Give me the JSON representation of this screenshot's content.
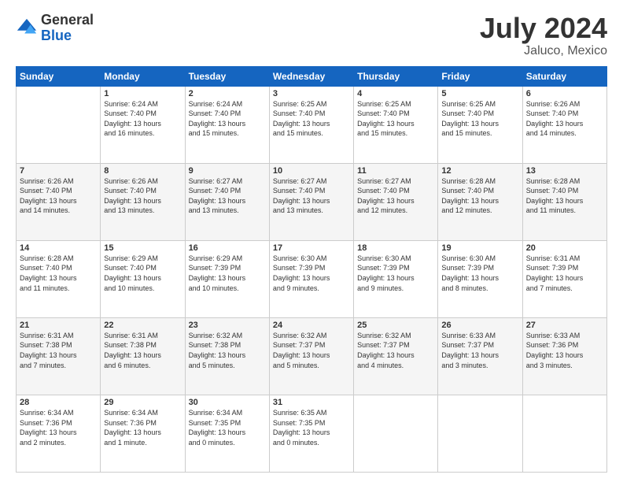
{
  "logo": {
    "general": "General",
    "blue": "Blue"
  },
  "title": "July 2024",
  "subtitle": "Jaluco, Mexico",
  "weekdays": [
    "Sunday",
    "Monday",
    "Tuesday",
    "Wednesday",
    "Thursday",
    "Friday",
    "Saturday"
  ],
  "weeks": [
    [
      {
        "day": "",
        "info": ""
      },
      {
        "day": "1",
        "info": "Sunrise: 6:24 AM\nSunset: 7:40 PM\nDaylight: 13 hours\nand 16 minutes."
      },
      {
        "day": "2",
        "info": "Sunrise: 6:24 AM\nSunset: 7:40 PM\nDaylight: 13 hours\nand 15 minutes."
      },
      {
        "day": "3",
        "info": "Sunrise: 6:25 AM\nSunset: 7:40 PM\nDaylight: 13 hours\nand 15 minutes."
      },
      {
        "day": "4",
        "info": "Sunrise: 6:25 AM\nSunset: 7:40 PM\nDaylight: 13 hours\nand 15 minutes."
      },
      {
        "day": "5",
        "info": "Sunrise: 6:25 AM\nSunset: 7:40 PM\nDaylight: 13 hours\nand 15 minutes."
      },
      {
        "day": "6",
        "info": "Sunrise: 6:26 AM\nSunset: 7:40 PM\nDaylight: 13 hours\nand 14 minutes."
      }
    ],
    [
      {
        "day": "7",
        "info": "Sunrise: 6:26 AM\nSunset: 7:40 PM\nDaylight: 13 hours\nand 14 minutes."
      },
      {
        "day": "8",
        "info": "Sunrise: 6:26 AM\nSunset: 7:40 PM\nDaylight: 13 hours\nand 13 minutes."
      },
      {
        "day": "9",
        "info": "Sunrise: 6:27 AM\nSunset: 7:40 PM\nDaylight: 13 hours\nand 13 minutes."
      },
      {
        "day": "10",
        "info": "Sunrise: 6:27 AM\nSunset: 7:40 PM\nDaylight: 13 hours\nand 13 minutes."
      },
      {
        "day": "11",
        "info": "Sunrise: 6:27 AM\nSunset: 7:40 PM\nDaylight: 13 hours\nand 12 minutes."
      },
      {
        "day": "12",
        "info": "Sunrise: 6:28 AM\nSunset: 7:40 PM\nDaylight: 13 hours\nand 12 minutes."
      },
      {
        "day": "13",
        "info": "Sunrise: 6:28 AM\nSunset: 7:40 PM\nDaylight: 13 hours\nand 11 minutes."
      }
    ],
    [
      {
        "day": "14",
        "info": "Sunrise: 6:28 AM\nSunset: 7:40 PM\nDaylight: 13 hours\nand 11 minutes."
      },
      {
        "day": "15",
        "info": "Sunrise: 6:29 AM\nSunset: 7:40 PM\nDaylight: 13 hours\nand 10 minutes."
      },
      {
        "day": "16",
        "info": "Sunrise: 6:29 AM\nSunset: 7:39 PM\nDaylight: 13 hours\nand 10 minutes."
      },
      {
        "day": "17",
        "info": "Sunrise: 6:30 AM\nSunset: 7:39 PM\nDaylight: 13 hours\nand 9 minutes."
      },
      {
        "day": "18",
        "info": "Sunrise: 6:30 AM\nSunset: 7:39 PM\nDaylight: 13 hours\nand 9 minutes."
      },
      {
        "day": "19",
        "info": "Sunrise: 6:30 AM\nSunset: 7:39 PM\nDaylight: 13 hours\nand 8 minutes."
      },
      {
        "day": "20",
        "info": "Sunrise: 6:31 AM\nSunset: 7:39 PM\nDaylight: 13 hours\nand 7 minutes."
      }
    ],
    [
      {
        "day": "21",
        "info": "Sunrise: 6:31 AM\nSunset: 7:38 PM\nDaylight: 13 hours\nand 7 minutes."
      },
      {
        "day": "22",
        "info": "Sunrise: 6:31 AM\nSunset: 7:38 PM\nDaylight: 13 hours\nand 6 minutes."
      },
      {
        "day": "23",
        "info": "Sunrise: 6:32 AM\nSunset: 7:38 PM\nDaylight: 13 hours\nand 5 minutes."
      },
      {
        "day": "24",
        "info": "Sunrise: 6:32 AM\nSunset: 7:37 PM\nDaylight: 13 hours\nand 5 minutes."
      },
      {
        "day": "25",
        "info": "Sunrise: 6:32 AM\nSunset: 7:37 PM\nDaylight: 13 hours\nand 4 minutes."
      },
      {
        "day": "26",
        "info": "Sunrise: 6:33 AM\nSunset: 7:37 PM\nDaylight: 13 hours\nand 3 minutes."
      },
      {
        "day": "27",
        "info": "Sunrise: 6:33 AM\nSunset: 7:36 PM\nDaylight: 13 hours\nand 3 minutes."
      }
    ],
    [
      {
        "day": "28",
        "info": "Sunrise: 6:34 AM\nSunset: 7:36 PM\nDaylight: 13 hours\nand 2 minutes."
      },
      {
        "day": "29",
        "info": "Sunrise: 6:34 AM\nSunset: 7:36 PM\nDaylight: 13 hours\nand 1 minute."
      },
      {
        "day": "30",
        "info": "Sunrise: 6:34 AM\nSunset: 7:35 PM\nDaylight: 13 hours\nand 0 minutes."
      },
      {
        "day": "31",
        "info": "Sunrise: 6:35 AM\nSunset: 7:35 PM\nDaylight: 13 hours\nand 0 minutes."
      },
      {
        "day": "",
        "info": ""
      },
      {
        "day": "",
        "info": ""
      },
      {
        "day": "",
        "info": ""
      }
    ]
  ]
}
